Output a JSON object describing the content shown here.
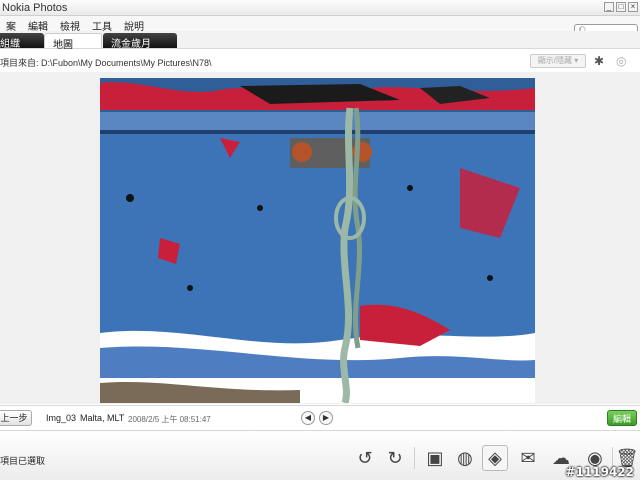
{
  "window": {
    "title": "Nokia Photos",
    "controls": [
      "_",
      "□",
      "×"
    ]
  },
  "menu": [
    "案",
    "編輯",
    "檢視",
    "工具",
    "說明"
  ],
  "tabs": [
    {
      "label": "組織",
      "active": false
    },
    {
      "label": "地圖",
      "active": true
    },
    {
      "label": "流金歲月",
      "active": false
    }
  ],
  "path": {
    "text": "項目來自: D:\\Fubon\\My Documents\\My Pictures\\N78\\",
    "show_hide": "顯示/隱藏 ▾"
  },
  "info": {
    "prev_label": "上一步",
    "filename": "Img_03",
    "location": "Malta, MLT",
    "datetime": "2008/2/5 上午 08:51:47",
    "edit_label": "編輯"
  },
  "status": {
    "text": "項目已選取"
  },
  "toolbar": {
    "icons": [
      "rotate-left-icon",
      "rotate-right-icon",
      "slideshow-icon",
      "globe-icon",
      "tag-icon",
      "mail-icon",
      "share-icon",
      "web-upload-icon",
      "trash-icon"
    ]
  },
  "watermark": "#1119422",
  "colors": {
    "tab_dark": "#111111",
    "edit_green": "#3a9b28",
    "photo_blue": "#3d74b8",
    "photo_red": "#c8203a"
  }
}
